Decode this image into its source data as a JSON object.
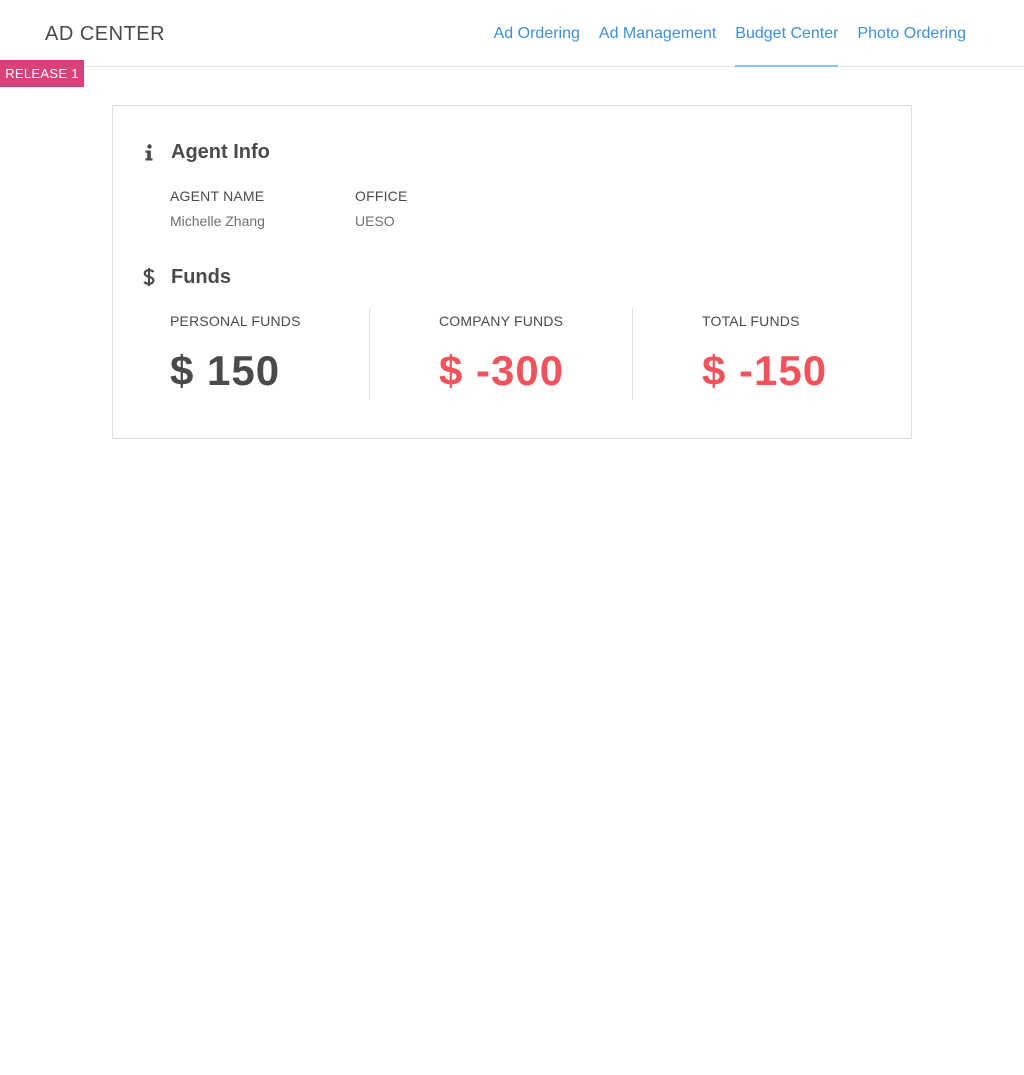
{
  "header": {
    "brand": "AD CENTER",
    "nav": [
      {
        "label": "Ad Ordering",
        "active": false
      },
      {
        "label": "Ad Management",
        "active": false
      },
      {
        "label": "Budget Center",
        "active": true
      },
      {
        "label": "Photo Ordering",
        "active": false
      }
    ]
  },
  "release_badge": "RELEASE 1",
  "agent_info": {
    "title": "Agent Info",
    "icon": "info-icon",
    "agent_name_label": "AGENT NAME",
    "agent_name": "Michelle Zhang",
    "office_label": "OFFICE",
    "office": "UESO"
  },
  "funds": {
    "title": "Funds",
    "icon": "dollar-icon",
    "personal": {
      "label": "PERSONAL FUNDS",
      "amount": "$ 150"
    },
    "company": {
      "label": "COMPANY FUNDS",
      "amount": "$ -300"
    },
    "total": {
      "label": "TOTAL FUNDS",
      "amount": "$ -150"
    }
  },
  "colors": {
    "accent": "#3f8fd8",
    "badge": "#d8417a",
    "negative": "#f0535b",
    "text": "#4a4a4a"
  }
}
